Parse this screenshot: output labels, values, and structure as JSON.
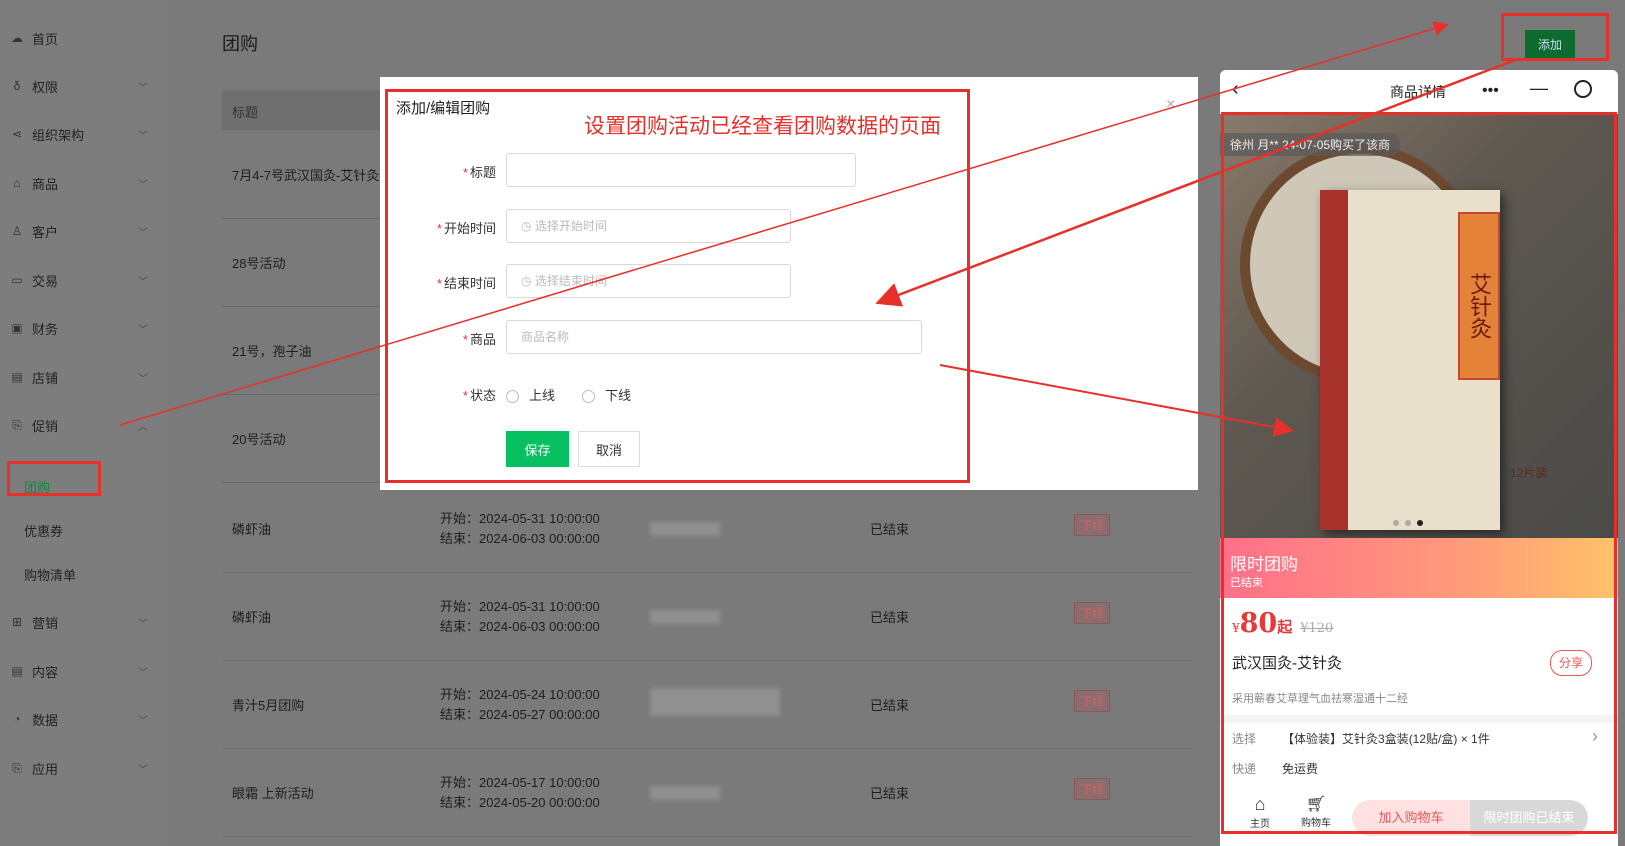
{
  "sidebar": {
    "items": [
      {
        "label": "首页",
        "icon": "cloud-icon",
        "chevron": false
      },
      {
        "label": "权限",
        "icon": "lock-icon",
        "chevron": true
      },
      {
        "label": "组织架构",
        "icon": "share-icon",
        "chevron": true
      },
      {
        "label": "商品",
        "icon": "bag-icon",
        "chevron": true
      },
      {
        "label": "客户",
        "icon": "user-icon",
        "chevron": true
      },
      {
        "label": "交易",
        "icon": "folder-icon",
        "chevron": true
      },
      {
        "label": "财务",
        "icon": "wallet-icon",
        "chevron": true
      },
      {
        "label": "店铺",
        "icon": "store-icon",
        "chevron": true
      },
      {
        "label": "促销",
        "icon": "gift-icon",
        "chevron": true
      },
      {
        "label": "营销",
        "icon": "grid-icon",
        "chevron": true
      },
      {
        "label": "内容",
        "icon": "doc-icon",
        "chevron": true
      },
      {
        "label": "数据",
        "icon": "pie-icon",
        "chevron": true
      },
      {
        "label": "应用",
        "icon": "app-icon",
        "chevron": true
      }
    ],
    "sub_items": [
      "团购",
      "优惠券",
      "购物清单"
    ]
  },
  "page": {
    "title": "团购",
    "add_label": "添加"
  },
  "table": {
    "header": "标题",
    "rows": [
      {
        "title": "7月4-7号武汉国灸-艾针灸"
      },
      {
        "title": "28号活动"
      },
      {
        "title": "21号，孢子油"
      },
      {
        "title": "20号活动"
      },
      {
        "title": "磷虾油",
        "start": "开始：2024-05-31 10:00:00",
        "end": "结束：2024-06-03 00:00:00",
        "state": "已结束",
        "badge": "下线"
      },
      {
        "title": "磷虾油",
        "start": "开始：2024-05-31 10:00:00",
        "end": "结束：2024-06-03 00:00:00",
        "state": "已结束",
        "badge": "下线"
      },
      {
        "title": "青汁5月团购",
        "start": "开始：2024-05-24 10:00:00",
        "end": "结束：2024-05-27 00:00:00",
        "state": "已结束",
        "badge": "下线"
      },
      {
        "title": "眼霜 上新活动",
        "start": "开始：2024-05-17 10:00:00",
        "end": "结束：2024-05-20 00:00:00",
        "state": "已结束",
        "badge": "下线"
      }
    ]
  },
  "modal": {
    "title": "添加/编辑团购",
    "annotation": "设置团购活动已经查看团购数据的页面",
    "fields": {
      "title_label": "标题",
      "start_label": "开始时间",
      "start_placeholder": "选择开始时间",
      "end_label": "结束时间",
      "end_placeholder": "选择结束时间",
      "product_label": "商品",
      "product_placeholder": "商品名称",
      "status_label": "状态",
      "status_online": "上线",
      "status_offline": "下线"
    },
    "save": "保存",
    "cancel": "取消"
  },
  "phone": {
    "title": "商品详情",
    "ticker": "徐州 月** 24-07-05购买了该商",
    "product_label_text": "艾针灸",
    "pack_text": "12片装",
    "promo_title": "限时团购",
    "promo_state": "已结束",
    "price_symbol": "¥",
    "price": "80",
    "price_suffix": "起",
    "price_old": "¥120",
    "name": "武汉国灸-艾针灸",
    "share": "分享",
    "desc": "采用蕲春艾草理气血祛寒湿通十二经",
    "select_key": "选择",
    "select_val": "【体验装】艾针灸3盒装(12贴/盒) × 1件",
    "ship_key": "快递",
    "ship_val": "免运费",
    "home": "主页",
    "cart": "购物车",
    "add_cart": "加入购物车",
    "buy": "限时团购已结束"
  },
  "colors": {
    "annotation": "#e8302a",
    "primary": "#07c160"
  }
}
